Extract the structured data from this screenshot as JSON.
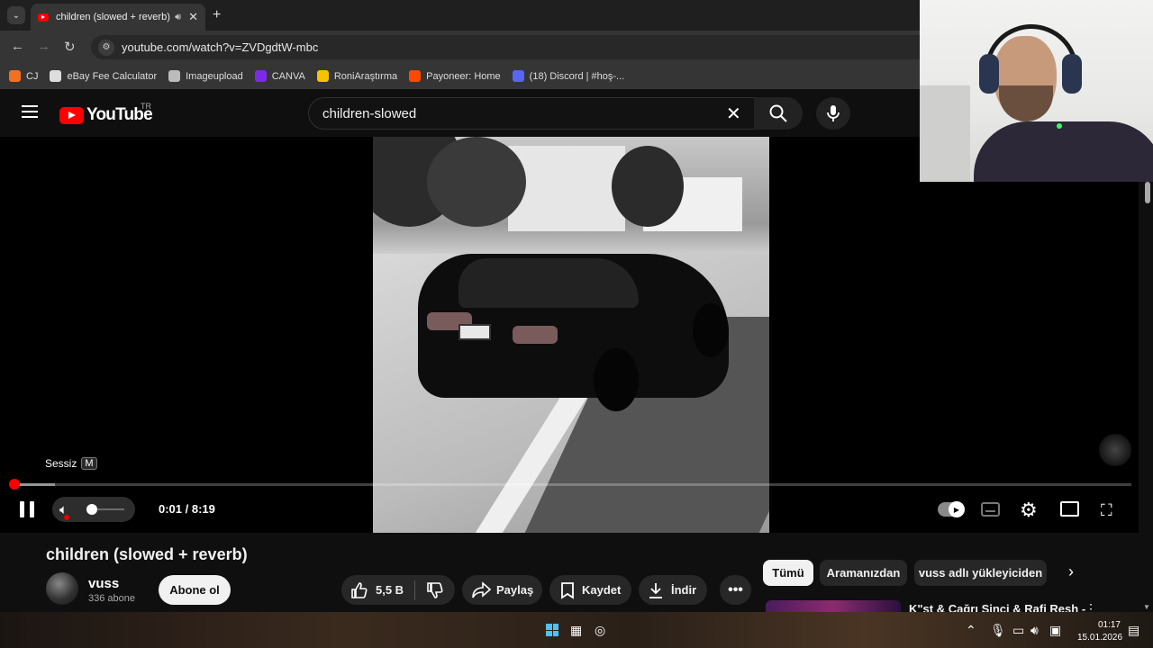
{
  "browser": {
    "tab_title": "children (slowed + reverb)",
    "tab_audio_icon": "speaker-icon",
    "tab_close": "✕",
    "new_tab": "+",
    "url": "youtube.com/watch?v=ZVDgdtW-mbc",
    "bookmarks": [
      {
        "label": "CJ",
        "icon": "cj-icon",
        "color": "#f37021"
      },
      {
        "label": "eBay Fee Calculator",
        "icon": "calculator-icon",
        "color": "#dddddd"
      },
      {
        "label": "Imageupload",
        "icon": "imageupload-icon",
        "color": "#bbbbbb"
      },
      {
        "label": "CANVA",
        "icon": "canva-icon",
        "color": "#7d2ae8"
      },
      {
        "label": "RoniAraştırma",
        "icon": "pacman-icon",
        "color": "#f5c400"
      },
      {
        "label": "Payoneer: Home",
        "icon": "payoneer-icon",
        "color": "#ff4800"
      },
      {
        "label": "(18) Discord | #hoş-...",
        "icon": "discord-icon",
        "color": "#5865f2"
      }
    ]
  },
  "youtube": {
    "logo_text": "YouTube",
    "region": "TR",
    "search_value": "children-slowed"
  },
  "player": {
    "mute_tooltip": "Sessiz",
    "mute_shortcut": "M",
    "time_current": "0:01",
    "time_separator": " / ",
    "time_total": "8:19",
    "progress_played_fraction": 0.002,
    "progress_loaded_fraction": 0.038,
    "volume_level": 0
  },
  "video": {
    "title": "children (slowed + reverb)",
    "channel_name": "vuss",
    "subscribers": "336 abone",
    "subscribe_label": "Abone ol",
    "likes": "5,5 B",
    "share_label": "Paylaş",
    "save_label": "Kaydet",
    "download_label": "İndir"
  },
  "chips": [
    "Tümü",
    "Aramanızdan",
    "vuss adlı yükleyiciden"
  ],
  "recommendation": {
    "title": "K\"st & Çağrı Sinci & Rafi Resh -"
  },
  "taskbar": {
    "time": "01:17",
    "date": "15.01.2026"
  },
  "colors": {
    "accent": "#ff0000",
    "background": "#0f0f0f",
    "pill": "#272727"
  }
}
